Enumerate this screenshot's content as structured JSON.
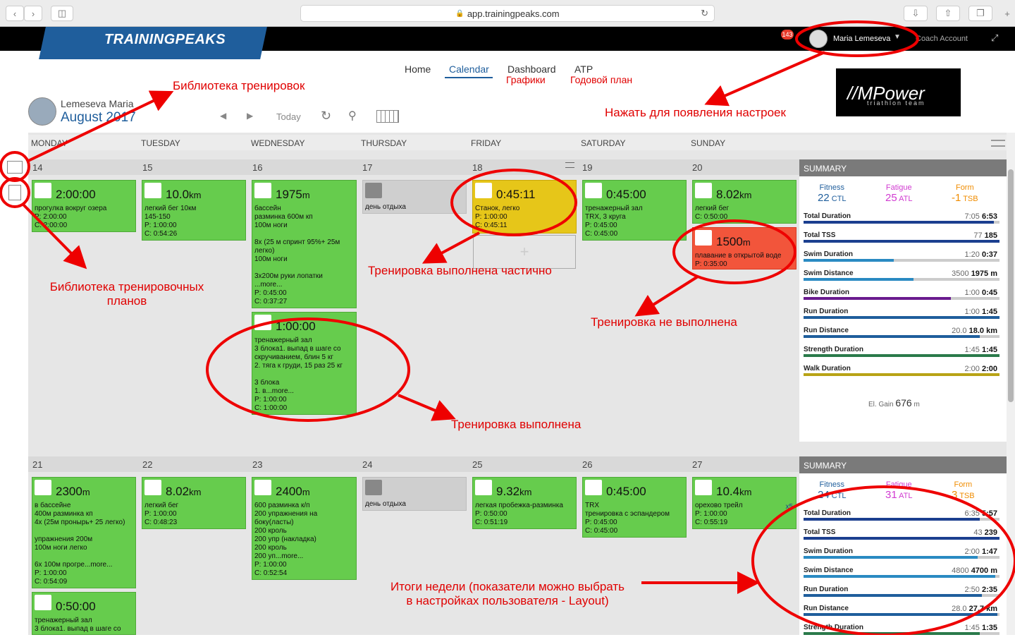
{
  "browser": {
    "url": "app.trainingpeaks.com"
  },
  "app": {
    "logo": "TRAININGPEAKS",
    "notif_count": "143",
    "user_name": "Maria Lemeseva",
    "coach_link": "Coach Account"
  },
  "nav": {
    "home": "Home",
    "calendar": "Calendar",
    "dashboard": "Dashboard",
    "atp": "ATP",
    "dashboard_note": "Графики",
    "atp_note": "Годовой план"
  },
  "athlete": {
    "name": "Lemeseva Maria",
    "month": "August 2017",
    "today": "Today"
  },
  "brand": {
    "main": "Power",
    "sub": "triathlon team"
  },
  "days": [
    "MONDAY",
    "TUESDAY",
    "WEDNESDAY",
    "THURSDAY",
    "FRIDAY",
    "SATURDAY",
    "SUNDAY"
  ],
  "week1": {
    "dates": [
      "14",
      "15",
      "16",
      "17",
      "18",
      "19",
      "20"
    ],
    "workouts": [
      {
        "big": "2:00:00",
        "desc": "прогулка вокруг озера\nP: 2:00:00\nC: 2:00:00"
      },
      {
        "big": "10.0",
        "unit": "km",
        "desc": "легкий бег 10км\n145-150\nP: 1:00:00\nC: 0:54:26"
      },
      {
        "big": "1975",
        "unit": "m",
        "desc": "бассейн\nразминка 600м кп\n100м ноги\n\n8х (25 м спринт 95%+ 25м\nлегко)\n100м ноги\n\n3х200м руки лопатки\n...more...\nP: 0:45:00\nC: 0:37:27"
      },
      {
        "big": "1:00:00",
        "desc": "тренажерный зал\n3 блока1. выпад в шаге со\nскручиванием, блин 5 кг\n2. тяга к груди, 15 раз 25 кг\n\n3 блока\n1. в...more...\nP: 1:00:00\nC: 1:00:00"
      },
      {
        "desc": "день отдыха"
      },
      {
        "big": "0:45:11",
        "desc": "Станок, легко\nP: 1:00:00\nC: 0:45:11"
      },
      {
        "big": "0:45:00",
        "desc": "тренажерный зал\nTRX, 3 круга\nP: 0:45:00\nC: 0:45:00"
      },
      {
        "big": "8.02",
        "unit": "km",
        "desc": "легкий бег\nC: 0:50:00"
      },
      {
        "big": "1500",
        "unit": "m",
        "desc": "плавание в открытой воде\nP: 0:35:00"
      }
    ],
    "summary": {
      "title": "SUMMARY",
      "fitness_label": "Fitness",
      "fitness": "22",
      "fatigue_label": "Fatigue",
      "fatigue": "25",
      "form_label": "Form",
      "form": "-1",
      "el_gain_label": "El. Gain",
      "el_gain": "676",
      "el_unit": "m",
      "rows": [
        {
          "label": "Total Duration",
          "plan": "7:05",
          "actual": "6:53",
          "color": "#1b3f8f",
          "fill": 0.97
        },
        {
          "label": "Total TSS",
          "plan": "77",
          "actual": "185",
          "color": "#1b3f8f",
          "fill": 1.0
        },
        {
          "label": "Swim Duration",
          "plan": "1:20",
          "actual": "0:37",
          "color": "#2a8ac2",
          "fill": 0.46
        },
        {
          "label": "Swim Distance",
          "plan": "3500",
          "actual": "1975 m",
          "color": "#2a8ac2",
          "fill": 0.56
        },
        {
          "label": "Bike Duration",
          "plan": "1:00",
          "actual": "0:45",
          "color": "#6a1b8f",
          "fill": 0.75
        },
        {
          "label": "Run Duration",
          "plan": "1:00",
          "actual": "1:45",
          "color": "#1f5e9c",
          "fill": 1.0
        },
        {
          "label": "Run Distance",
          "plan": "20.0",
          "actual": "18.0 km",
          "color": "#1f5e9c",
          "fill": 0.9
        },
        {
          "label": "Strength Duration",
          "plan": "1:45",
          "actual": "1:45",
          "color": "#2a7a4a",
          "fill": 1.0
        },
        {
          "label": "Walk Duration",
          "plan": "2:00",
          "actual": "2:00",
          "color": "#b8a316",
          "fill": 1.0
        }
      ]
    }
  },
  "week2": {
    "dates": [
      "21",
      "22",
      "23",
      "24",
      "25",
      "26",
      "27"
    ],
    "workouts": [
      {
        "big": "2300",
        "unit": "m",
        "desc": "в бассейне\n400м разминка кп\n4х (25м пронырь+ 25 легко)\n\nупражнения 200м\n100м ноги легко\n\n6х 100м прогре...more...\nP: 1:00:00\nC: 0:54:09"
      },
      {
        "big": "0:50:00",
        "desc": "тренажерный зал\n3 блока1. выпад в шаге со"
      },
      {
        "big": "8.02",
        "unit": "km",
        "desc": "легкий бег\nP: 1:00:00\nC: 0:48:23"
      },
      {
        "big": "2400",
        "unit": "m",
        "desc": "600 разминка к/п\n200 упражнения на\nбоку(ласты)\n200 кроль\n200 упр (накладка)\n200 кроль\n200 уп...more...\nP: 1:00:00\nC: 0:52:54"
      },
      {
        "desc": "день отдыха"
      },
      {
        "big": "9.32",
        "unit": "km",
        "desc": "легкая пробежка-разминка\nP: 0:50:00\nC: 0:51:19"
      },
      {
        "big": "0:45:00",
        "desc": "TRX\nтренировка с эспандером\nP: 0:45:00\nC: 0:45:00"
      },
      {
        "big": "10.4",
        "unit": "km",
        "desc": "орехово трейл\nP: 1:00:00\nC: 0:55:19",
        "badge": "x5"
      }
    ],
    "summary": {
      "title": "SUMMARY",
      "fitness_label": "Fitness",
      "fitness": "24",
      "fatigue_label": "Fatigue",
      "fatigue": "31",
      "form_label": "Form",
      "form": "3",
      "rows": [
        {
          "label": "Total Duration",
          "plan": "6:35",
          "actual": "5:57",
          "color": "#1b3f8f",
          "fill": 0.9
        },
        {
          "label": "Total TSS",
          "plan": "43",
          "actual": "239",
          "color": "#1b3f8f",
          "fill": 1.0
        },
        {
          "label": "Swim Duration",
          "plan": "2:00",
          "actual": "1:47",
          "color": "#2a8ac2",
          "fill": 0.89
        },
        {
          "label": "Swim Distance",
          "plan": "4800",
          "actual": "4700 m",
          "color": "#2a8ac2",
          "fill": 0.98
        },
        {
          "label": "Run Duration",
          "plan": "2:50",
          "actual": "2:35",
          "color": "#1f5e9c",
          "fill": 0.91
        },
        {
          "label": "Run Distance",
          "plan": "28.0",
          "actual": "27.7 km",
          "color": "#1f5e9c",
          "fill": 0.99
        },
        {
          "label": "Strength Duration",
          "plan": "1:45",
          "actual": "1:35",
          "color": "#2a7a4a",
          "fill": 0.9
        }
      ]
    }
  },
  "annotations": {
    "workout_library": "Библиотека тренировок",
    "settings": "Нажать для появления настроек",
    "plan_library": "Библиотека тренировочных\nпланов",
    "partial": "Тренировка выполнена частично",
    "not_done": "Тренировка не выполнена",
    "done": "Тренировка выполнена",
    "weekly": "Итоги недели (показатели можно выбрать\nв настройках пользователя - Layout)"
  },
  "ctl": "CTL",
  "atl": "ATL",
  "tsb": "TSB"
}
